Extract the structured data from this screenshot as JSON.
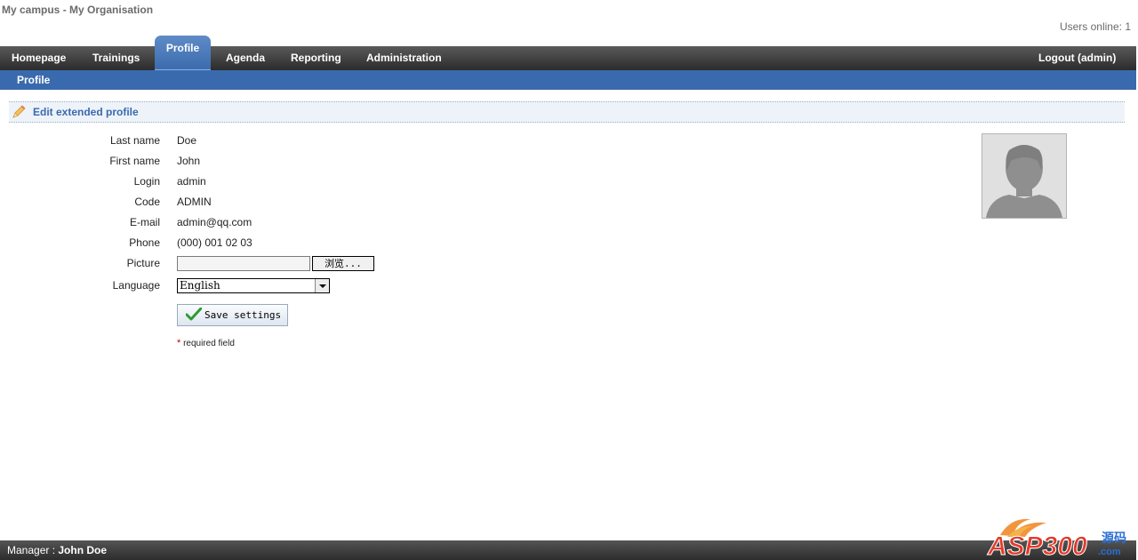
{
  "header": {
    "site_title": "My campus - My Organisation",
    "users_online": "Users online: 1"
  },
  "nav": {
    "items": [
      "Homepage",
      "Trainings",
      "Profile",
      "Agenda",
      "Reporting",
      "Administration"
    ],
    "active": "Profile",
    "logout": "Logout (admin)"
  },
  "subnav": {
    "items": [
      "Profile"
    ]
  },
  "section": {
    "title": "Edit extended profile",
    "icon": "pencil-icon"
  },
  "form": {
    "fields": [
      {
        "label": "Last name",
        "value": "Doe"
      },
      {
        "label": "First name",
        "value": "John"
      },
      {
        "label": "Login",
        "value": "admin"
      },
      {
        "label": "Code",
        "value": "ADMIN"
      },
      {
        "label": "E-mail",
        "value": "admin@qq.com"
      },
      {
        "label": "Phone",
        "value": "(000) 001 02 03"
      }
    ],
    "picture_label": "Picture",
    "browse_label": "浏览...",
    "language_label": "Language",
    "language_value": "English",
    "save_label": "Save settings",
    "required_star": "*",
    "required_note": "required field"
  },
  "footer": {
    "manager_label": "Manager : ",
    "manager_name": "John Doe"
  },
  "watermark": {
    "text": "ASP300",
    "suffix": "源码",
    "domain": ".com"
  },
  "colors": {
    "nav_bg": "#3b3b3b",
    "accent": "#3a6aae",
    "section_bg": "#eef3f9"
  }
}
